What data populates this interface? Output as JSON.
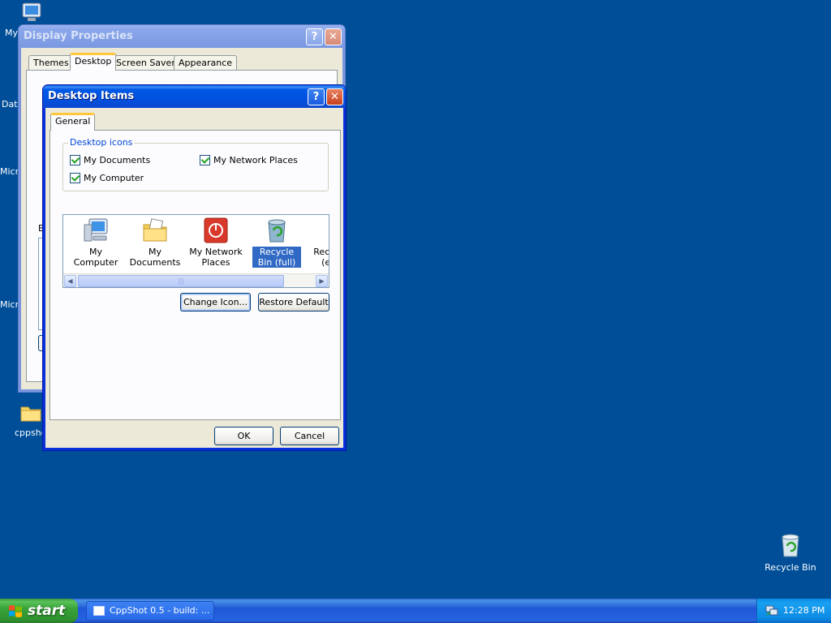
{
  "desktop": {
    "icons": [
      {
        "label": "My",
        "icon": "my-computer-icon"
      },
      {
        "label": "Data",
        "icon": "folder-icon"
      },
      {
        "label": "Micro",
        "icon": "app-icon"
      },
      {
        "label": "Micro",
        "icon": "app-icon"
      },
      {
        "label": "cppshot",
        "icon": "folder-icon"
      },
      {
        "label": "Recycle Bin",
        "icon": "recycle-bin-icon"
      }
    ]
  },
  "display_properties": {
    "title": "Display Properties",
    "tabs": [
      "Themes",
      "Desktop",
      "Screen Saver",
      "Appearance"
    ],
    "active_tab": "Desktop",
    "peek_label": "B",
    "help_label": "?",
    "close_label": "✕"
  },
  "desktop_items": {
    "title": "Desktop Items",
    "help_label": "?",
    "close_label": "✕",
    "tab": "General",
    "group_label": "Desktop icons",
    "checkboxes": [
      {
        "label": "My Documents",
        "checked": true
      },
      {
        "label": "My Network Places",
        "checked": true
      },
      {
        "label": "My Computer",
        "checked": true
      }
    ],
    "icons": [
      {
        "label": "My Computer",
        "icon": "my-computer-icon"
      },
      {
        "label": "My Documents",
        "icon": "my-documents-icon"
      },
      {
        "label": "My Network Places",
        "icon": "network-places-icon"
      },
      {
        "label": "Recycle Bin (full)",
        "icon": "recycle-bin-full-icon",
        "selected": true
      },
      {
        "label": "Recycle Bin (empty)",
        "icon": "recycle-bin-empty-icon"
      }
    ],
    "change_icon_label": "Change Icon...",
    "restore_default_label": "Restore Default",
    "ok_label": "OK",
    "cancel_label": "Cancel"
  },
  "taskbar": {
    "start_label": "start",
    "task_button_label": "CppShot 0.5 - build: ...",
    "clock": "12:28 PM"
  },
  "colors": {
    "desktop_bg": "#004e98",
    "titlebar_active": "#0058e6",
    "selection": "#316ac5",
    "start_green": "#39a339"
  }
}
